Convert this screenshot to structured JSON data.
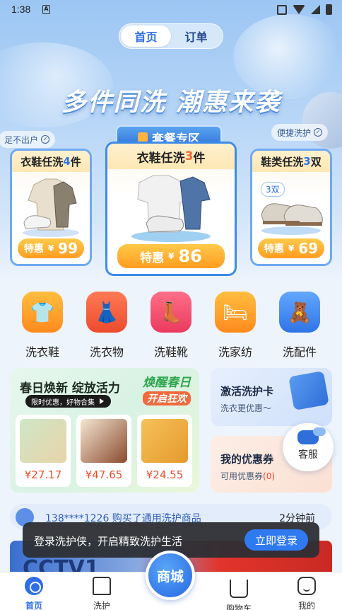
{
  "status_bar": {
    "time": "1:38",
    "sim_label": "A"
  },
  "top_tabs": [
    {
      "label": "首页",
      "active": true
    },
    {
      "label": "订单",
      "active": false
    }
  ],
  "hero": {
    "headline": "多件同洗  潮惠来袭",
    "package_title": "套餐专区",
    "chip_left": "足不出户",
    "chip_right": "便捷洗护"
  },
  "cards": {
    "left": {
      "title_pre": "衣鞋任洗",
      "title_num": "4",
      "title_post": "件",
      "price_label": "特惠",
      "currency": "¥",
      "price": "99"
    },
    "mid": {
      "title_pre": "衣鞋任洗",
      "title_num": "3",
      "title_post": "件",
      "price_label": "特惠",
      "currency": "¥",
      "price": "86"
    },
    "right": {
      "title_pre": "鞋类任洗",
      "title_num": "3",
      "title_post": "双",
      "badge": "3双",
      "price_label": "特惠",
      "currency": "¥",
      "price": "69"
    }
  },
  "categories": [
    {
      "label": "洗衣鞋",
      "icon": "shirt-shoe-icon",
      "color": "#ff9a2e"
    },
    {
      "label": "洗衣物",
      "icon": "dress-icon",
      "color": "#f0573d"
    },
    {
      "label": "洗鞋靴",
      "icon": "boot-icon",
      "color": "#f2476a"
    },
    {
      "label": "洗家纺",
      "icon": "bed-icon",
      "color": "#ff9a2e"
    },
    {
      "label": "洗配件",
      "icon": "bear-icon",
      "color": "#3b86f2"
    }
  ],
  "promo": {
    "title": "春日焕新 绽放活力",
    "tag": "限时优惠，好物合集",
    "art_line1": "焕醒春日",
    "art_line2": "开启狂欢",
    "items": [
      {
        "price": "¥27.17"
      },
      {
        "price": "¥47.65"
      },
      {
        "price": "¥24.55"
      }
    ]
  },
  "side_cards": {
    "activate": {
      "title": "激活洗护卡",
      "subtitle": "洗衣更优惠～"
    },
    "coupons": {
      "title": "我的优惠券",
      "subtitle": "可用优惠券",
      "count": "(0)"
    }
  },
  "service": {
    "label": "客服"
  },
  "notice": {
    "text": "138****1226 购买了通用洗护商品",
    "time_ago": "2分钟前"
  },
  "banner": {
    "brand": "CCTV1"
  },
  "toast": {
    "message": "登录洗护侠，开启精致洗护生活",
    "button": "立即登录"
  },
  "tabbar": {
    "home": "首页",
    "care": "洗护",
    "mall": "商城",
    "cart": "购物车",
    "me": "我的"
  },
  "colors": {
    "accent": "#2f6fe4",
    "price_orange": "#ff9c20",
    "price_red": "#e94e2f"
  }
}
